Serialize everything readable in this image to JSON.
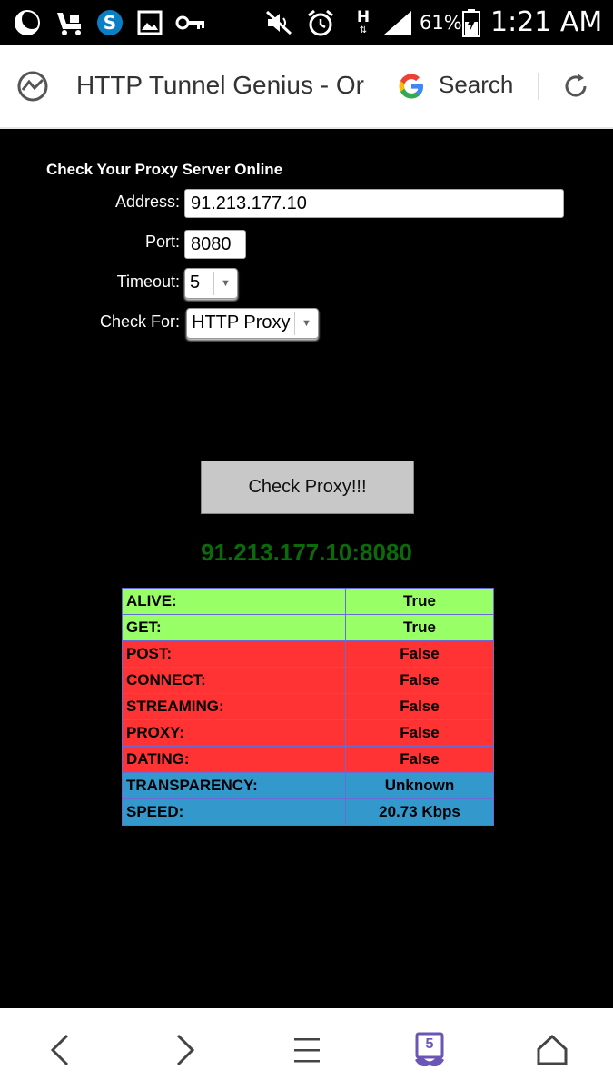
{
  "status_bar": {
    "battery_pct": "61%",
    "time": "1:21 AM",
    "network": "H",
    "icons": [
      "moon-icon",
      "baby-stroller-icon",
      "skype-icon",
      "image-icon",
      "key-icon",
      "mute-icon",
      "alarm-icon",
      "network-h-icon",
      "signal-icon",
      "battery-icon"
    ]
  },
  "browser": {
    "page_title": "HTTP Tunnel Genius - Or",
    "search_label": "Search",
    "icons": [
      "site-logo-icon",
      "google-g-icon",
      "refresh-icon"
    ]
  },
  "form": {
    "heading": "Check Your Proxy Server Online",
    "address_label": "Address:",
    "address_value": "91.213.177.10",
    "port_label": "Port:",
    "port_value": "8080",
    "timeout_label": "Timeout:",
    "timeout_value": "5",
    "check_for_label": "Check For:",
    "check_for_value": "HTTP Proxy",
    "button_label": "Check Proxy!!!"
  },
  "result": {
    "address": "91.213.177.10:8080",
    "rows": [
      {
        "label": "ALIVE:",
        "value": "True",
        "color": "#99ff66"
      },
      {
        "label": "GET:",
        "value": "True",
        "color": "#99ff66"
      },
      {
        "label": "POST:",
        "value": "False",
        "color": "#ff3333"
      },
      {
        "label": "CONNECT:",
        "value": "False",
        "color": "#ff3333"
      },
      {
        "label": "STREAMING:",
        "value": "False",
        "color": "#ff3333"
      },
      {
        "label": "PROXY:",
        "value": "False",
        "color": "#ff3333"
      },
      {
        "label": "DATING:",
        "value": "False",
        "color": "#ff3333"
      },
      {
        "label": "TRANSPARENCY:",
        "value": "Unknown",
        "color": "#3399cc"
      },
      {
        "label": "SPEED:",
        "value": "20.73 Kbps",
        "color": "#3399cc"
      }
    ]
  },
  "bottom_nav": {
    "tab_count": "5",
    "icons": [
      "back-icon",
      "forward-icon",
      "menu-icon",
      "tabs-icon",
      "home-icon"
    ]
  }
}
